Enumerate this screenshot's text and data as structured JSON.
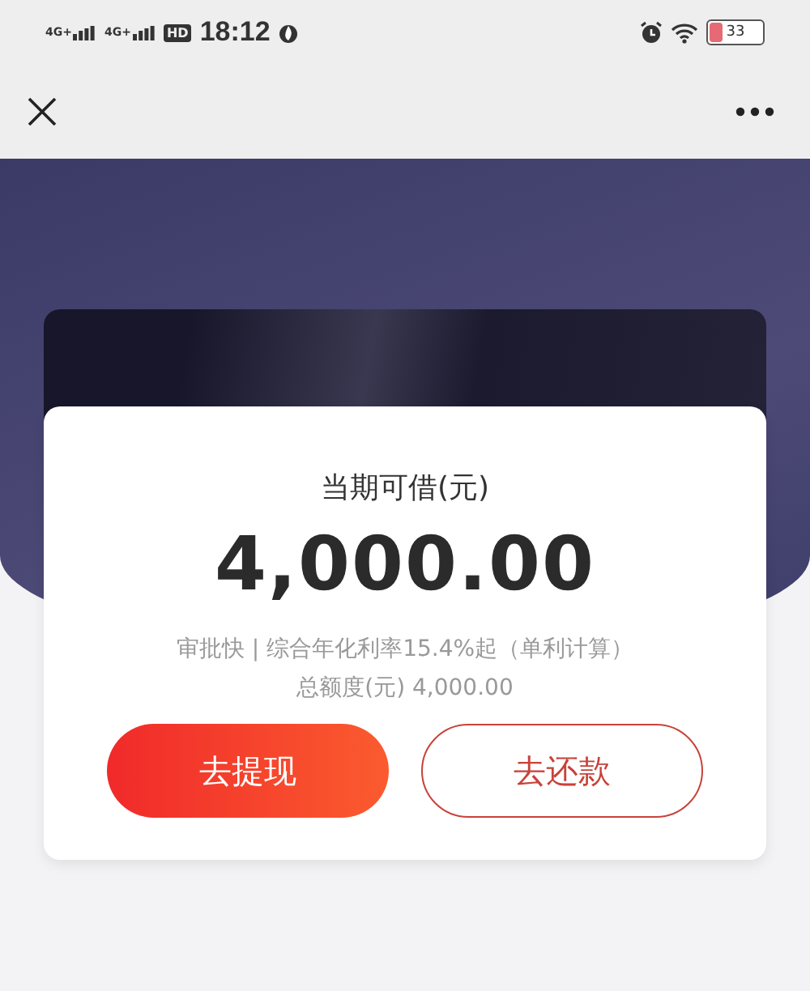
{
  "status_bar": {
    "networks": [
      "4G+",
      "4G+"
    ],
    "hd": "HD",
    "time": "18:12",
    "battery": "33"
  },
  "card": {
    "label": "当期可借(元)",
    "amount": "4,000.00",
    "info": "审批快 | 综合年化利率15.4%起（单利计算）",
    "total": "总额度(元) 4,000.00"
  },
  "buttons": [
    {
      "label": "去提现",
      "kind": "primary"
    },
    {
      "label": "去还款",
      "kind": "outline"
    }
  ]
}
